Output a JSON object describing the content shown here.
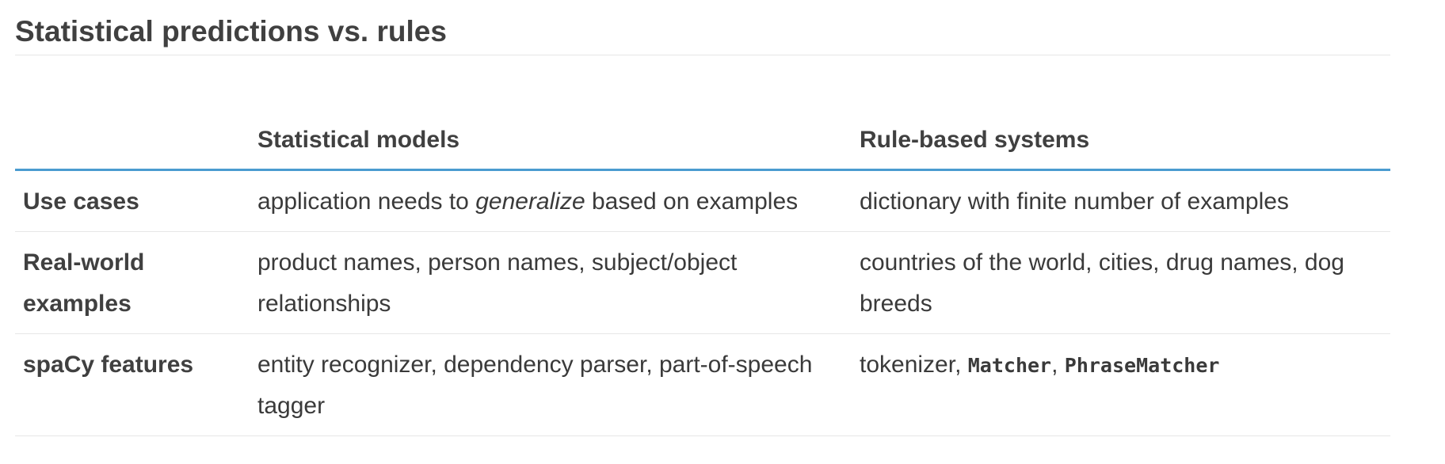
{
  "heading": "Statistical predictions vs. rules",
  "table": {
    "headers": [
      "",
      "Statistical models",
      "Rule-based systems"
    ],
    "rows": [
      {
        "label": "Use cases",
        "statistical": {
          "before": "application needs to ",
          "emphasis": "generalize",
          "after": " based on examples"
        },
        "rules": "dictionary with finite number of examples"
      },
      {
        "label": "Real-world examples",
        "statistical": "product names, person names, subject/object relationships",
        "rules": "countries of the world, cities, drug names, dog breeds"
      },
      {
        "label": "spaCy features",
        "statistical": "entity recognizer, dependency parser, part-of-speech tagger",
        "rules": {
          "prefix": "tokenizer, ",
          "code1": "Matcher",
          "sep": ", ",
          "code2": "PhraseMatcher"
        }
      }
    ]
  },
  "colors": {
    "header_rule": "#4a9cd0",
    "row_rule": "#e6e6e6",
    "text": "#333333"
  }
}
